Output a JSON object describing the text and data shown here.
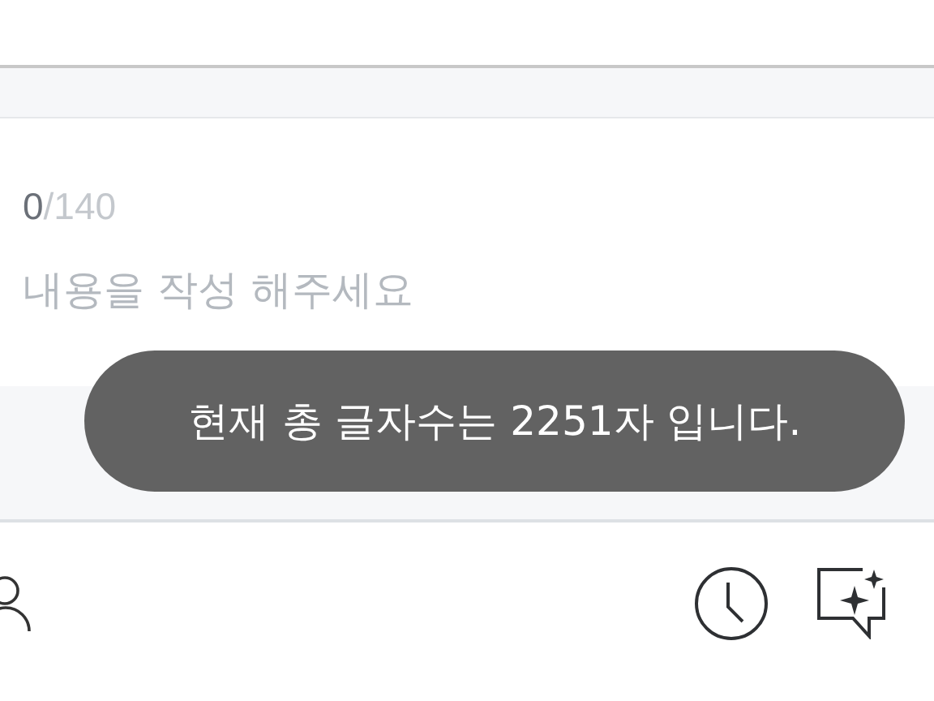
{
  "composer": {
    "count": "0",
    "limit": "/140",
    "placeholder": "내용을 작성 해주세요"
  },
  "toast": {
    "message": "현재 총 글자수는 2251자 입니다."
  }
}
